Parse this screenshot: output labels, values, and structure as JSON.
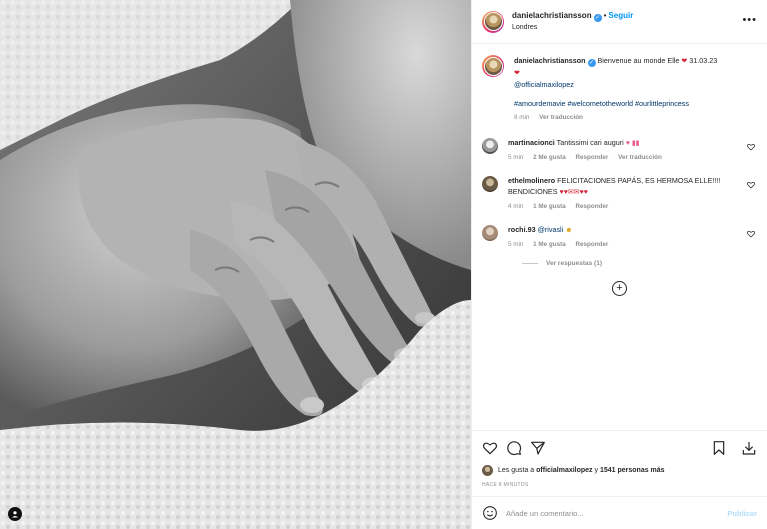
{
  "post": {
    "photo_alt": "Fotografía en blanco y negro de la mano de un bebé",
    "username": "danielachristiansson",
    "follow_label": "Seguir",
    "location": "Londres",
    "more_label": "•••"
  },
  "caption": {
    "username": "danielachristiansson",
    "text": "Bienvenue au monde Elle",
    "emoji_1": "❤",
    "date": "31.03.23",
    "emoji_2": "❤",
    "mention": "@officialmaxilopez",
    "hashtags": "#amourdemavie #welcometotheworld #ourlittleprincess",
    "time": "8 min",
    "translate": "Ver traducción"
  },
  "comments": [
    {
      "username": "martinacionci",
      "text": "Tantissimi cari auguri",
      "emojis": "♥ ▮▮",
      "time": "5 min",
      "likes": "2 Me gusta",
      "reply": "Responder",
      "translate": "Ver traducción"
    },
    {
      "username": "ethelmolinero",
      "text": "FELICITACIONES PAPÁS, ES HERMOSA ELLE!!!! BENDICIONES",
      "emojis": "♥♥✉✉♥♥",
      "time": "4 min",
      "likes": "1 Me gusta",
      "reply": "Responder"
    },
    {
      "username": "rochi.93",
      "mention": "@rivasli",
      "emojis": "☻",
      "time": "5 min",
      "likes": "1 Me gusta",
      "reply": "Responder"
    }
  ],
  "view_replies": "Ver respuestas (1)",
  "likes": {
    "prefix": "Les gusta a",
    "user": "officialmaxilopez",
    "middle": "y",
    "count": "1541 personas más"
  },
  "timestamp": "HACE 8 MINUTOS",
  "add_comment": {
    "placeholder": "Añade un comentario...",
    "publish_label": "Publicar"
  },
  "icons": [
    "heart-icon",
    "comment-icon",
    "share-icon",
    "bookmark-icon",
    "download-icon",
    "emoji-icon",
    "plus-circle-icon",
    "user-icon",
    "verified-icon"
  ]
}
